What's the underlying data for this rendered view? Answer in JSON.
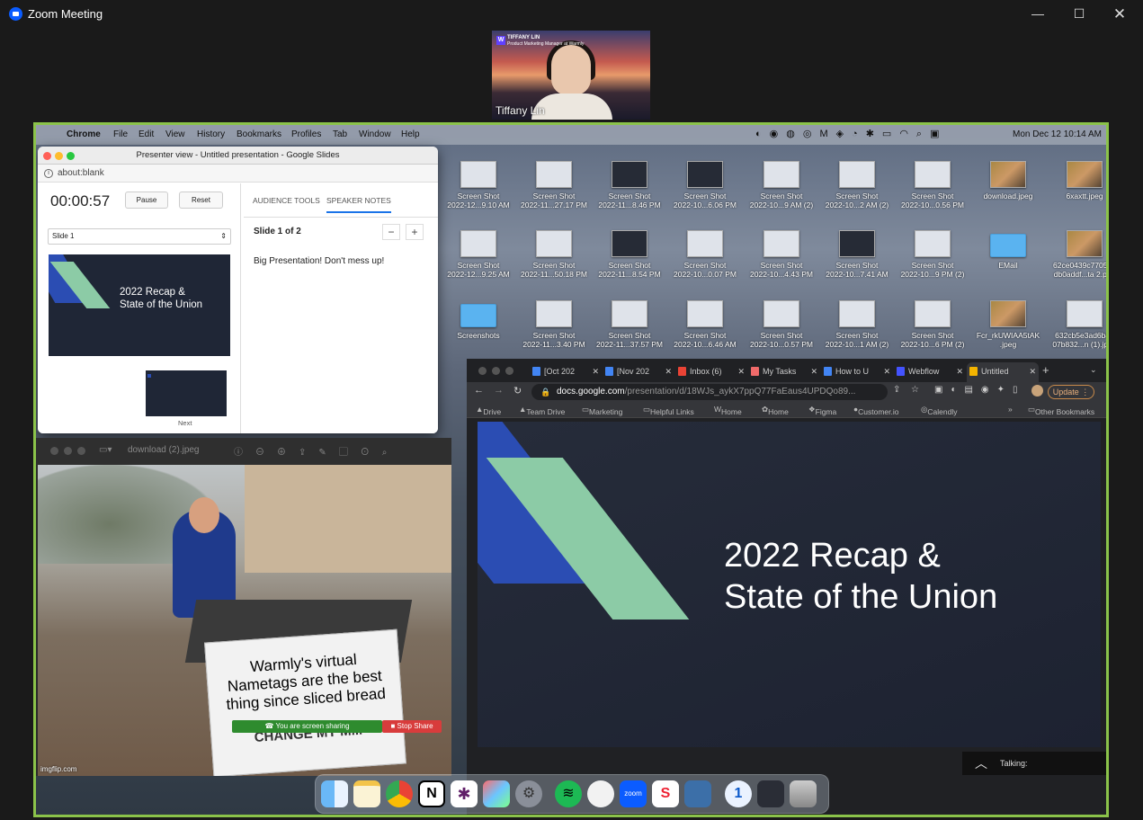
{
  "window": {
    "title": "Zoom Meeting"
  },
  "participant": {
    "name": "Tiffany Lin",
    "tag_name": "TIFFANY LIN",
    "tag_role": "Product Marketing Manager at Warmly"
  },
  "mac_menubar": {
    "items": [
      "Chrome",
      "File",
      "Edit",
      "View",
      "History",
      "Bookmarks",
      "Profiles",
      "Tab",
      "Window",
      "Help"
    ],
    "clock": "Mon Dec 12  10:14 AM"
  },
  "desktop_icons": [
    {
      "l1": "Screen Shot",
      "l2": "2022-12...9.10 AM",
      "kind": "shot"
    },
    {
      "l1": "Screen Shot",
      "l2": "2022-11...27.17 PM",
      "kind": "shot"
    },
    {
      "l1": "Screen Shot",
      "l2": "2022-11...8.46 PM",
      "kind": "dark"
    },
    {
      "l1": "Screen Shot",
      "l2": "2022-10...6.06 PM",
      "kind": "dark"
    },
    {
      "l1": "Screen Shot",
      "l2": "2022-10...9 AM (2)",
      "kind": "shot"
    },
    {
      "l1": "Screen Shot",
      "l2": "2022-10...2 AM (2)",
      "kind": "shot"
    },
    {
      "l1": "Screen Shot",
      "l2": "2022-10...0.56 PM",
      "kind": "shot"
    },
    {
      "l1": "download.jpeg",
      "l2": "",
      "kind": "photo"
    },
    {
      "l1": "6xaxtt.jpeg",
      "l2": "",
      "kind": "photo"
    },
    {
      "l1": "Screen Shot",
      "l2": "2022-12...9.25 AM",
      "kind": "shot"
    },
    {
      "l1": "Screen Shot",
      "l2": "2022-11...50.18 PM",
      "kind": "shot"
    },
    {
      "l1": "Screen Shot",
      "l2": "2022-11...8.54 PM",
      "kind": "dark"
    },
    {
      "l1": "Screen Shot",
      "l2": "2022-10...0.07 PM",
      "kind": "shot"
    },
    {
      "l1": "Screen Shot",
      "l2": "2022-10...4.43 PM",
      "kind": "shot"
    },
    {
      "l1": "Screen Shot",
      "l2": "2022-10...7.41 AM",
      "kind": "dark"
    },
    {
      "l1": "Screen Shot",
      "l2": "2022-10...9 PM (2)",
      "kind": "shot"
    },
    {
      "l1": "EMail",
      "l2": "",
      "kind": "folder"
    },
    {
      "l1": "62ce0439c7705a7",
      "l2": "db0addf...ta 2.png",
      "kind": "photo"
    },
    {
      "l1": "Screenshots",
      "l2": "",
      "kind": "folder"
    },
    {
      "l1": "Screen Shot",
      "l2": "2022-11...3.40 PM",
      "kind": "shot"
    },
    {
      "l1": "Screen Shot",
      "l2": "2022-11...37.57 PM",
      "kind": "shot"
    },
    {
      "l1": "Screen Shot",
      "l2": "2022-10...6.46 AM",
      "kind": "shot"
    },
    {
      "l1": "Screen Shot",
      "l2": "2022-10...0.57 PM",
      "kind": "shot"
    },
    {
      "l1": "Screen Shot",
      "l2": "2022-10...1 AM (2)",
      "kind": "shot"
    },
    {
      "l1": "Screen Shot",
      "l2": "2022-10...6 PM (2)",
      "kind": "shot"
    },
    {
      "l1": "Fcr_rkUWIAA5tAK",
      "l2": ".jpeg",
      "kind": "photo"
    },
    {
      "l1": "632cb5e3ad6b44",
      "l2": "07b832...n (1).jpeg",
      "kind": "shot"
    }
  ],
  "presenter": {
    "window_title": "Presenter view - Untitled presentation - Google Slides",
    "url": "about:blank",
    "timer": "00:00:57",
    "pause": "Pause",
    "reset": "Reset",
    "slide_select": "Slide 1",
    "slide_title_l1": "2022 Recap &",
    "slide_title_l2": "State of the Union",
    "next_label": "Next",
    "tab_audience": "AUDIENCE TOOLS",
    "tab_notes": "SPEAKER NOTES",
    "slide_counter": "Slide 1 of 2",
    "minus": "−",
    "plus": "+",
    "notes_text": "Big Presentation! Don't mess up!"
  },
  "preview_app": {
    "filename": "download (2).jpeg",
    "meme_line1": "Warmly's virtual",
    "meme_line2": "Nametags are the best",
    "meme_line3": "thing since sliced bread",
    "meme_bottom": "CHANGE MY M...",
    "watermark": "imgflip.com"
  },
  "share_controls": {
    "sharing": "You are screen sharing",
    "stop": "Stop Share"
  },
  "chrome": {
    "tabs": [
      "[Oct 202",
      "[Nov 202",
      "Inbox (6)",
      "My Tasks",
      "How to U",
      "Webflow",
      "Untitled"
    ],
    "url_host": "docs.google.com",
    "url_path": "/presentation/d/18WJs_aykX7ppQ77FaEaus4UPDQo89...",
    "update": "Update",
    "bookmarks": [
      "Drive",
      "Team Drive",
      "Marketing",
      "Helpful Links",
      "Home",
      "Home",
      "Figma",
      "Customer.io",
      "Calendly"
    ],
    "other_bookmarks": "Other Bookmarks",
    "slide_title_l1": "2022 Recap &",
    "slide_title_l2": "State of the Union"
  },
  "talking": "Talking:",
  "colors": {
    "share_border": "#8bc34a",
    "slide_bg": "#1f2636",
    "slide_blue": "#2b4db3",
    "slide_green": "#8ccba6",
    "zoom_blue": "#0b5cff"
  }
}
